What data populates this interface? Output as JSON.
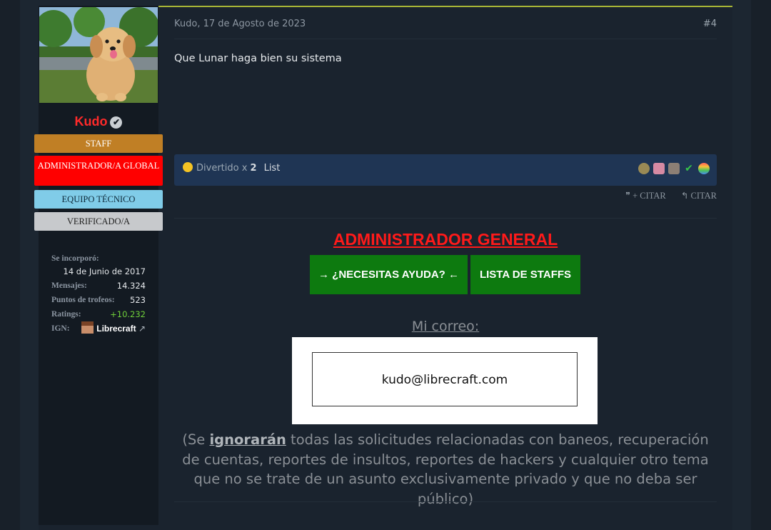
{
  "user": {
    "name": "Kudo",
    "banners": [
      "STAFF",
      "ADMINISTRADOR/A GLOBAL",
      "EQUIPO TÉCNICO",
      "VERIFICADO/A"
    ],
    "stats": {
      "joined_label": "Se incorporó:",
      "joined_value": "14 de Junio de 2017",
      "messages_label": "Mensajes:",
      "messages_value": "14.324",
      "trophies_label": "Puntos de trofeos:",
      "trophies_value": "523",
      "ratings_label": "Ratings:",
      "ratings_value": "+10.232",
      "ign_label": "IGN:",
      "ign_value": "Librecraft"
    }
  },
  "post": {
    "meta": "Kudo, 17 de Agosto de 2023",
    "number": "#4",
    "text": "Que Lunar haga bien su sistema",
    "reactions": {
      "summary_prefix": "Divertido x ",
      "summary_count": "2",
      "list_label": "List"
    },
    "actions": {
      "multiquote": "+ CITAR",
      "quote": "CITAR"
    }
  },
  "signature": {
    "title": "ADMINISTRADOR GENERAL",
    "help_button": "→ ¿NECESITAS AYUDA? ←",
    "staff_button": "LISTA DE STAFFS",
    "mail_label": "Mi correo:",
    "email": "kudo@librecraft.com",
    "notice_pre": "(Se ",
    "notice_emph": "ignorarán",
    "notice_post": " todas las solicitudes relacionadas con baneos, recuperación de cuentas, reportes de insultos, reportes de hackers y cualquier otro tema que no se trate de un asunto exclusivamente privado y que no deba ser público)"
  },
  "colors": {
    "accent_line": "#a7b536",
    "username": "#ff2a2a",
    "staff_banner": "#c07f25",
    "admin_banner": "#ff0000",
    "tech_banner": "#80cce8",
    "verified_banner": "#c7c9cc",
    "signature_title": "#ff1a1a",
    "signature_buttons": "#0d7a0f"
  }
}
